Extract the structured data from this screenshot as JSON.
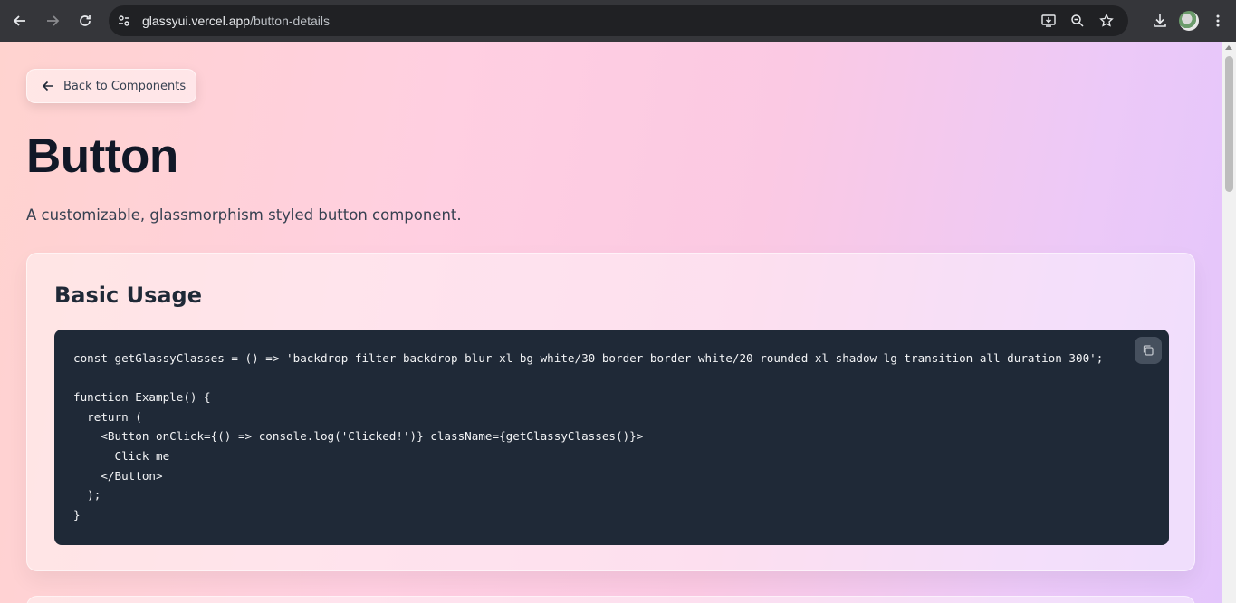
{
  "browser": {
    "url_domain": "glassyui.vercel.app",
    "url_path": "/button-details"
  },
  "page": {
    "back_label": "Back to Components",
    "title": "Button",
    "subtitle": "A customizable, glassmorphism styled button component.",
    "basic_usage": {
      "heading": "Basic Usage",
      "code_lines": [
        "const getGlassyClasses = () => 'backdrop-filter backdrop-blur-xl bg-white/30 border border-white/20 rounded-xl shadow-lg transition-all duration-300';",
        "",
        "function Example() {",
        "  return (",
        "    <Button onClick={() => console.log('Clicked!')} className={getGlassyClasses()}>",
        "      Click me",
        "    </Button>",
        "  );",
        "}"
      ]
    }
  }
}
